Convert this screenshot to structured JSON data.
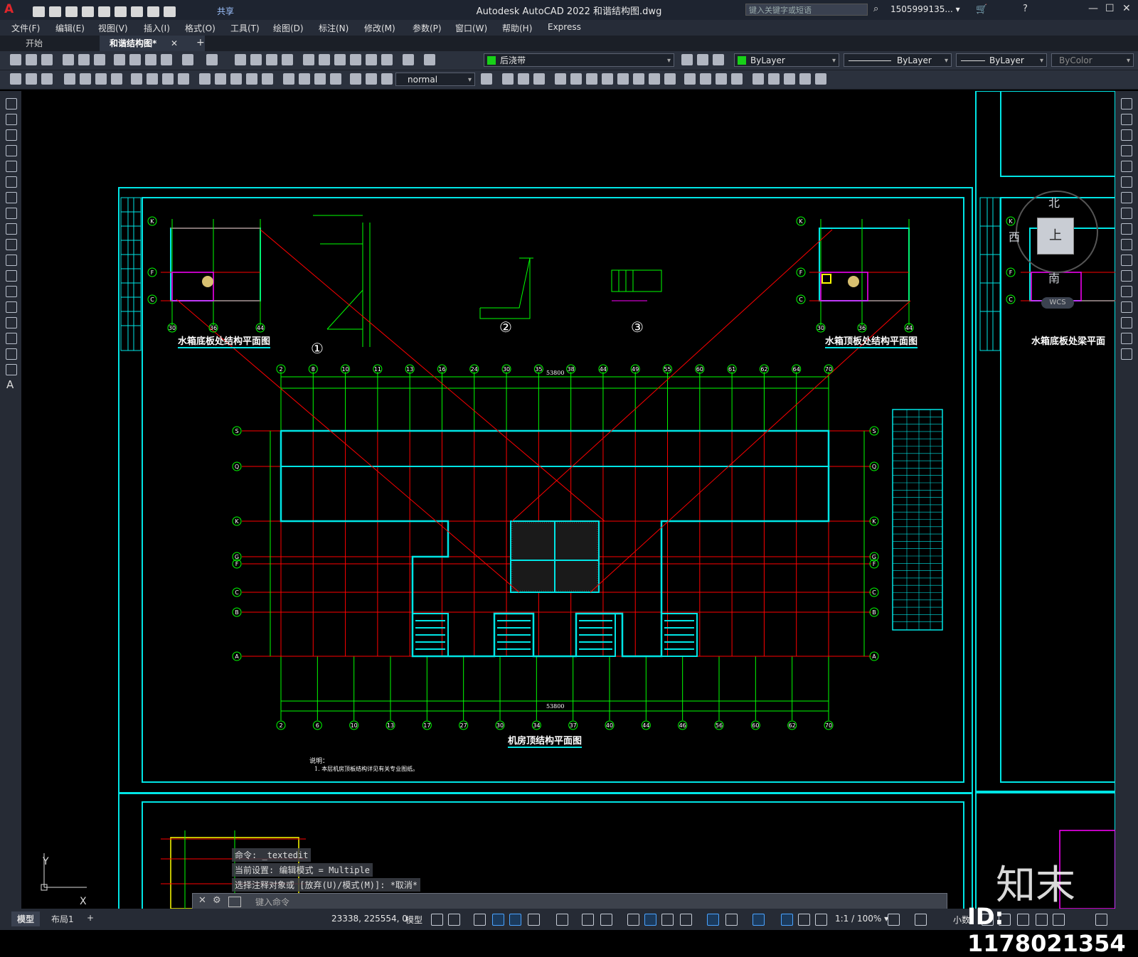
{
  "app": {
    "title": "Autodesk AutoCAD 2022    和谐结构图.dwg",
    "logo": "A",
    "share_label": "共享",
    "search_placeholder": "键入关键字或短语",
    "user": "1505999135... ▾",
    "colors": {
      "accent_cyan": "#00ffff",
      "green": "#00ff00",
      "red": "#ff0000",
      "magenta": "#ff00ff"
    }
  },
  "menu": [
    "文件(F)",
    "编辑(E)",
    "视图(V)",
    "插入(I)",
    "格式(O)",
    "工具(T)",
    "绘图(D)",
    "标注(N)",
    "修改(M)",
    "参数(P)",
    "窗口(W)",
    "帮助(H)",
    "Express"
  ],
  "tabs": {
    "start": "开始",
    "drawing": "和谐结构图*",
    "close": "✕",
    "add": "+"
  },
  "properties": {
    "layer": "后浇带",
    "color": "ByLayer",
    "linetype": "ByLayer",
    "lineweight": "ByLayer",
    "plotstyle": "ByColor",
    "dimstyle": "normal"
  },
  "viewcube": {
    "north": "北",
    "south": "南",
    "west": "西",
    "top": "上",
    "wcs": "WCS"
  },
  "drawing": {
    "titles": {
      "tank_bottom": "水箱底板处结构平面图",
      "tank_top": "水箱顶板处结构平面图",
      "tank_beam": "水箱底板处梁平面",
      "machine_room": "机房顶结构平面图"
    },
    "detail_numbers": [
      "①",
      "②",
      "③"
    ],
    "note_title": "说明：",
    "note_line": "1. 本层机房顶板结构详见有关专业图纸。",
    "grid_top": [
      "2",
      "8",
      "10",
      "11",
      "13",
      "16",
      "24",
      "30",
      "35",
      "38",
      "44",
      "49",
      "55",
      "60",
      "61",
      "62",
      "64",
      "70"
    ],
    "grid_bottom": [
      "2",
      "6",
      "10",
      "13",
      "17",
      "27",
      "30",
      "34",
      "37",
      "40",
      "44",
      "46",
      "56",
      "60",
      "62",
      "70"
    ],
    "grid_rows": [
      "S",
      "Q",
      "K",
      "G",
      "F",
      "C",
      "B",
      "A"
    ],
    "small_rows": [
      "K",
      "F",
      "C"
    ],
    "small_cols": [
      "30",
      "36",
      "44"
    ],
    "overall_dim": "53800"
  },
  "command": {
    "history": [
      "命令: _textedit",
      "当前设置: 编辑模式 = Multiple",
      "选择注释对象或 [放弃(U)/模式(M)]: *取消*"
    ],
    "placeholder": "键入命令"
  },
  "status": {
    "layouts": [
      "模型",
      "布局1",
      "+"
    ],
    "coords": "23338, 225554, 0",
    "model": "模型",
    "scale": "1:1 / 100% ▾",
    "units": "小数"
  },
  "ucs": {
    "x": "X",
    "y": "Y"
  },
  "watermark": {
    "brand": "知末",
    "id": "ID: 1178021354"
  }
}
